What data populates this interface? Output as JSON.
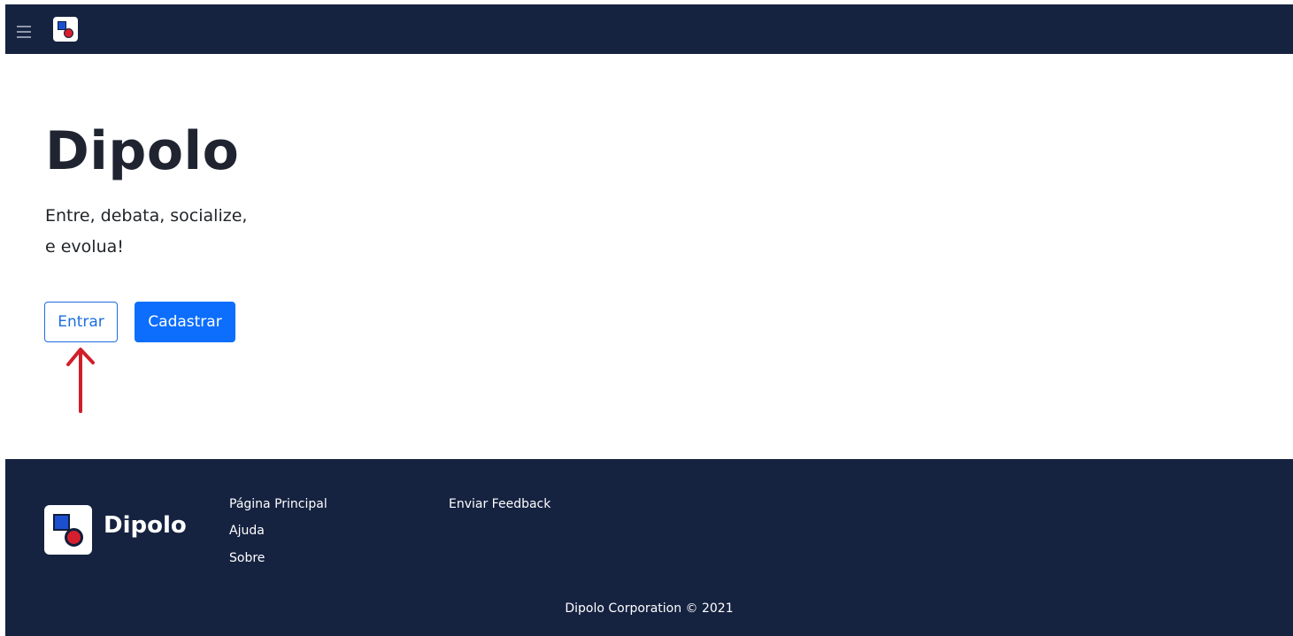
{
  "navbar": {
    "menu_icon": "hamburger-menu-icon",
    "logo_icon": "dipolo-logo-icon",
    "background_color": "#152240"
  },
  "hero": {
    "title": "Dipolo",
    "tagline_line1": "Entre, debata, socialize,",
    "tagline_line2": "e evolua!",
    "login_button": "Entrar",
    "signup_button": "Cadastrar",
    "primary_color": "#0d6efd",
    "annotation": "red-arrow-up-icon"
  },
  "footer": {
    "brand": "Dipolo",
    "links_col1": [
      "Página Principal",
      "Ajuda",
      "Sobre"
    ],
    "links_col2": [
      "Enviar Feedback"
    ],
    "copyright": "Dipolo Corporation © 2021",
    "background_color": "#152240"
  }
}
